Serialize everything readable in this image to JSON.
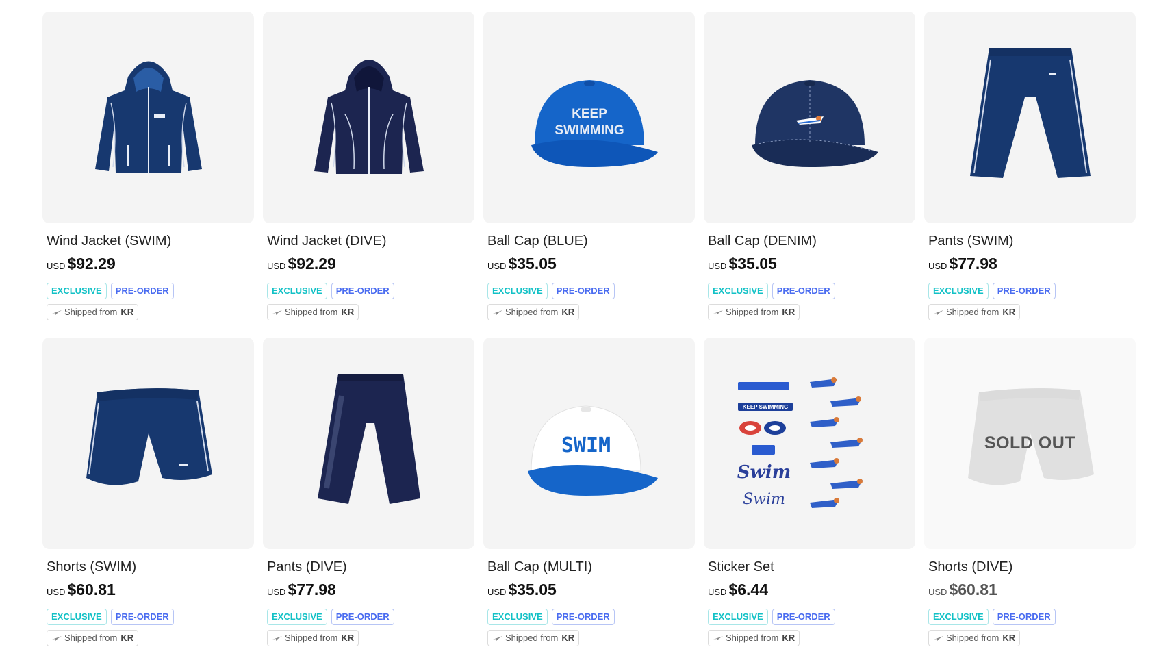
{
  "products": [
    {
      "name": "Wind Jacket (SWIM)",
      "currency": "USD",
      "price": "$92.29",
      "badge_exclusive": "EXCLUSIVE",
      "badge_preorder": "PRE-ORDER",
      "ship_prefix": "Shipped from",
      "ship_country": "KR"
    },
    {
      "name": "Wind Jacket (DIVE)",
      "currency": "USD",
      "price": "$92.29",
      "badge_exclusive": "EXCLUSIVE",
      "badge_preorder": "PRE-ORDER",
      "ship_prefix": "Shipped from",
      "ship_country": "KR"
    },
    {
      "name": "Ball Cap (BLUE)",
      "currency": "USD",
      "price": "$35.05",
      "badge_exclusive": "EXCLUSIVE",
      "badge_preorder": "PRE-ORDER",
      "ship_prefix": "Shipped from",
      "ship_country": "KR",
      "print_line1": "KEEP",
      "print_line2": "SWIMMING"
    },
    {
      "name": "Ball Cap (DENIM)",
      "currency": "USD",
      "price": "$35.05",
      "badge_exclusive": "EXCLUSIVE",
      "badge_preorder": "PRE-ORDER",
      "ship_prefix": "Shipped from",
      "ship_country": "KR"
    },
    {
      "name": "Pants (SWIM)",
      "currency": "USD",
      "price": "$77.98",
      "badge_exclusive": "EXCLUSIVE",
      "badge_preorder": "PRE-ORDER",
      "ship_prefix": "Shipped from",
      "ship_country": "KR"
    },
    {
      "name": "Shorts (SWIM)",
      "currency": "USD",
      "price": "$60.81",
      "badge_exclusive": "EXCLUSIVE",
      "badge_preorder": "PRE-ORDER",
      "ship_prefix": "Shipped from",
      "ship_country": "KR"
    },
    {
      "name": "Pants (DIVE)",
      "currency": "USD",
      "price": "$77.98",
      "badge_exclusive": "EXCLUSIVE",
      "badge_preorder": "PRE-ORDER",
      "ship_prefix": "Shipped from",
      "ship_country": "KR"
    },
    {
      "name": "Ball Cap (MULTI)",
      "currency": "USD",
      "price": "$35.05",
      "badge_exclusive": "EXCLUSIVE",
      "badge_preorder": "PRE-ORDER",
      "ship_prefix": "Shipped from",
      "ship_country": "KR",
      "print_line1": "SWIM"
    },
    {
      "name": "Sticker Set",
      "currency": "USD",
      "price": "$6.44",
      "badge_exclusive": "EXCLUSIVE",
      "badge_preorder": "PRE-ORDER",
      "ship_prefix": "Shipped from",
      "ship_country": "KR",
      "print_line1": "KEEP SWIMMING",
      "print_line2": "Swim"
    },
    {
      "name": "Shorts (DIVE)",
      "currency": "USD",
      "price": "$60.81",
      "badge_exclusive": "EXCLUSIVE",
      "badge_preorder": "PRE-ORDER",
      "ship_prefix": "Shipped from",
      "ship_country": "KR",
      "overlay": "SOLD OUT"
    }
  ],
  "colors": {
    "navy": "#17386f",
    "dark_navy": "#1c2550",
    "royal_blue": "#1565c9",
    "denim": "#1f3564",
    "exclusive": "#12c1c6",
    "preorder": "#4a6cf0"
  }
}
